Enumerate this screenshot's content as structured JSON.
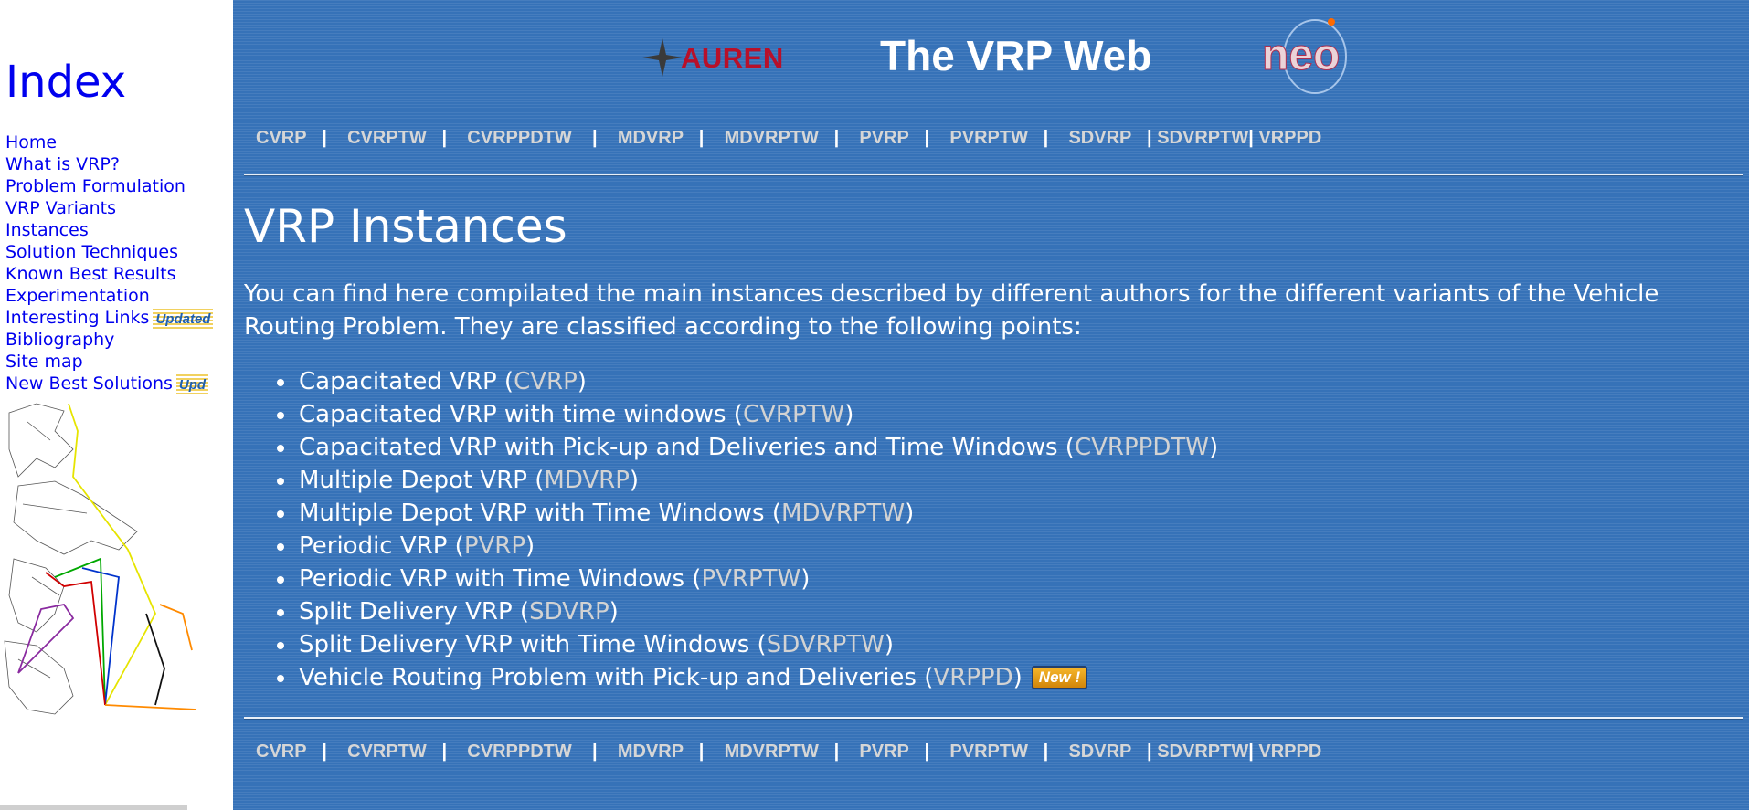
{
  "sidebar": {
    "title": "Index",
    "items": [
      {
        "label": "Home"
      },
      {
        "label": "What is VRP?"
      },
      {
        "label": "Problem Formulation"
      },
      {
        "label": "VRP Variants"
      },
      {
        "label": "Instances"
      },
      {
        "label": "Solution Techniques"
      },
      {
        "label": "Known Best Results"
      },
      {
        "label": "Experimentation"
      },
      {
        "label": "Interesting Links",
        "badge": "Updated"
      },
      {
        "label": "Bibliography"
      },
      {
        "label": "Site map"
      },
      {
        "label": "New Best Solutions",
        "badge": "Upd"
      }
    ]
  },
  "header": {
    "title": "The VRP Web",
    "left_logo_text": "AUREN",
    "right_logo_text": "neo"
  },
  "nav": {
    "links": [
      "CVRP",
      "CVRPTW",
      "CVRPPDTW",
      "MDVRP",
      "MDVRPTW",
      "PVRP",
      "PVRPTW",
      "SDVRP",
      "SDVRPTW",
      "VRPPD"
    ],
    "separator": "|"
  },
  "main": {
    "title": "VRP Instances",
    "intro": "You can find here compilated the main instances described by different authors for the different variants of the Vehicle Routing Problem. They are classified according to the following points:",
    "variants": [
      {
        "text": "Capacitated VRP",
        "code": "CVRP"
      },
      {
        "text": "Capacitated VRP with time windows",
        "code": "CVRPTW"
      },
      {
        "text": "Capacitated VRP with Pick-up and Deliveries and Time Windows",
        "code": "CVRPPDTW"
      },
      {
        "text": "Multiple Depot VRP",
        "code": "MDVRP"
      },
      {
        "text": "Multiple Depot VRP with Time Windows",
        "code": "MDVRPTW"
      },
      {
        "text": "Periodic VRP",
        "code": "PVRP"
      },
      {
        "text": "Periodic VRP with Time Windows",
        "code": "PVRPTW"
      },
      {
        "text": "Split Delivery VRP",
        "code": "SDVRP"
      },
      {
        "text": "Split Delivery VRP with Time Windows",
        "code": "SDVRPTW"
      },
      {
        "text": "Vehicle Routing Problem with Pick-up and Deliveries",
        "code": "VRPPD",
        "badge": "New !"
      }
    ]
  },
  "colors": {
    "main_bg": "#3672b8",
    "link_blue": "#0000ee",
    "nav_link": "#d6d6d6",
    "auren_red": "#b8102a"
  }
}
